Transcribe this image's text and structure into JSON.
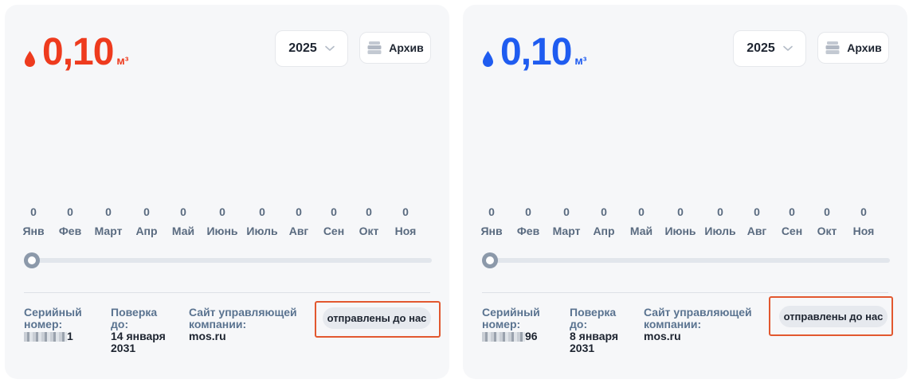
{
  "cards": [
    {
      "id": "cold",
      "reading_value": "0,10",
      "reading_unit": "м³",
      "accent_color": "#ee3b1e",
      "year": "2025",
      "archive_label": "Архив",
      "months": [
        {
          "name": "Янв",
          "value": "0"
        },
        {
          "name": "Фев",
          "value": "0"
        },
        {
          "name": "Март",
          "value": "0"
        },
        {
          "name": "Апр",
          "value": "0"
        },
        {
          "name": "Май",
          "value": "0"
        },
        {
          "name": "Июнь",
          "value": "0"
        },
        {
          "name": "Июль",
          "value": "0"
        },
        {
          "name": "Авг",
          "value": "0"
        },
        {
          "name": "Сен",
          "value": "0"
        },
        {
          "name": "Окт",
          "value": "0"
        },
        {
          "name": "Ноя",
          "value": "0"
        }
      ],
      "serial_label_1": "Серийный",
      "serial_label_2": "номер:",
      "serial_suffix": "1",
      "check_label_1": "Поверка",
      "check_label_2": "до:",
      "check_value_1": "14 января",
      "check_value_2": "2031",
      "company_label_1": "Сайт управляющей",
      "company_label_2": "компании:",
      "company_value": "mos.ru",
      "status": "отправлены до нас"
    },
    {
      "id": "hot",
      "reading_value": "0,10",
      "reading_unit": "м³",
      "accent_color": "#1f5cf0",
      "year": "2025",
      "archive_label": "Архив",
      "months": [
        {
          "name": "Янв",
          "value": "0"
        },
        {
          "name": "Фев",
          "value": "0"
        },
        {
          "name": "Март",
          "value": "0"
        },
        {
          "name": "Апр",
          "value": "0"
        },
        {
          "name": "Май",
          "value": "0"
        },
        {
          "name": "Июнь",
          "value": "0"
        },
        {
          "name": "Июль",
          "value": "0"
        },
        {
          "name": "Авг",
          "value": "0"
        },
        {
          "name": "Сен",
          "value": "0"
        },
        {
          "name": "Окт",
          "value": "0"
        },
        {
          "name": "Ноя",
          "value": "0"
        }
      ],
      "serial_label_1": "Серийный",
      "serial_label_2": "номер:",
      "serial_suffix": "96",
      "check_label_1": "Поверка",
      "check_label_2": "до:",
      "check_value_1": "8 января",
      "check_value_2": "2031",
      "company_label_1": "Сайт управляющей",
      "company_label_2": "компании:",
      "company_value": "mos.ru",
      "status": "отправлены до нас"
    }
  ],
  "icons": {
    "drop": "water-drop-icon",
    "archive": "archive-box-icon",
    "chevron": "chevron-down-icon"
  },
  "colors": {
    "highlight_border": "#e2582f",
    "label": "#5a7390",
    "text": "#1d2430"
  }
}
